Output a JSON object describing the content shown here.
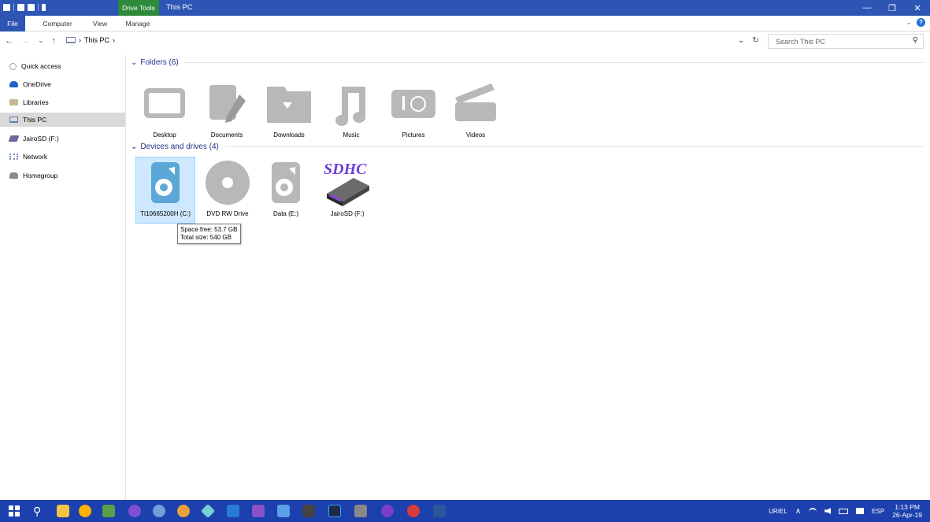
{
  "titlebar": {
    "context_tab": "Drive Tools",
    "title": "This PC",
    "minimize": "—",
    "restore": "❐",
    "close": "✕"
  },
  "ribbon": {
    "tabs": [
      {
        "label": "File"
      },
      {
        "label": "Computer"
      },
      {
        "label": "View"
      },
      {
        "label": "Manage"
      }
    ],
    "collapse": "⌄",
    "help": "?"
  },
  "address": {
    "back": "←",
    "forward": "→",
    "recent": "⌄",
    "up": "↑",
    "crumb_sep": "›",
    "crumb": "This PC",
    "dropdown": "⌄",
    "refresh": "↻",
    "search_placeholder": "Search This PC",
    "search_icon": "⚲"
  },
  "sidebar": {
    "items": [
      {
        "label": "Quick access",
        "icon": "quick-access-icon",
        "color": "#a0a0a0"
      },
      {
        "label": "OneDrive",
        "icon": "onedrive-icon",
        "color": "#1c62c9"
      },
      {
        "label": "Libraries",
        "icon": "libraries-icon",
        "color": "#c8b790"
      },
      {
        "label": "This PC",
        "icon": "this-pc-icon",
        "color": "#5b7fb8"
      },
      {
        "label": "JairoSD (F:)",
        "icon": "sd-card-icon",
        "color": "#6a6a9a"
      },
      {
        "label": "Network",
        "icon": "network-icon",
        "color": "#7a8ab8"
      },
      {
        "label": "Homegroup",
        "icon": "homegroup-icon",
        "color": "#8a8a8a"
      }
    ]
  },
  "groups": {
    "folders": {
      "title": "Folders (6)",
      "chevron": "⌄"
    },
    "devices": {
      "title": "Devices and drives (4)",
      "chevron": "⌄"
    }
  },
  "folders": [
    {
      "label": "Desktop",
      "icon": "desktop-icon"
    },
    {
      "label": "Documents",
      "icon": "documents-icon"
    },
    {
      "label": "Downloads",
      "icon": "downloads-icon"
    },
    {
      "label": "Music",
      "icon": "music-icon"
    },
    {
      "label": "Pictures",
      "icon": "pictures-icon"
    },
    {
      "label": "Videos",
      "icon": "videos-icon"
    }
  ],
  "drives": [
    {
      "label": "TI10665200H (C:)",
      "icon": "hard-drive-icon",
      "selected": true
    },
    {
      "label": "DVD RW Drive",
      "icon": "dvd-drive-icon"
    },
    {
      "label": "Data (E:)",
      "icon": "hard-drive-icon"
    },
    {
      "label": "JairoSD (F:)",
      "icon": "sd-card-icon",
      "badge": "SDHC"
    }
  ],
  "tooltip": {
    "line1": "Space free: 53.7 GB",
    "line2": "Total size: 540 GB"
  },
  "taskbar": {
    "user": "URIEL",
    "lang": "ESP",
    "time": "1:13 PM",
    "date": "26-Apr-19",
    "tray_up": "∧"
  },
  "colors": {
    "accent": "#2d55b4",
    "drive_tools": "#2e8a3a",
    "group_header": "#1e3287",
    "selection": "#cde8ff",
    "sdhc": "#6a3ee0"
  }
}
